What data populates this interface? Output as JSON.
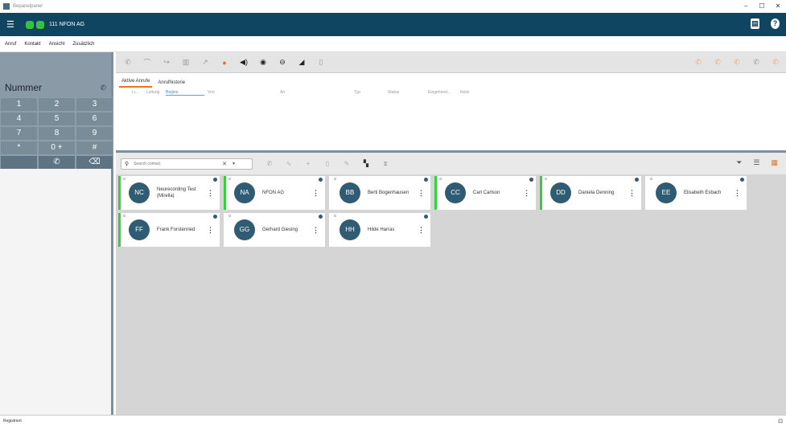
{
  "window": {
    "title": "Bepanelpanel"
  },
  "appbar": {
    "account": "111 NFON AG"
  },
  "menu": [
    "Anruf",
    "Kontakt",
    "Ansicht",
    "Zusätzlich"
  ],
  "dialpad": {
    "number_placeholder": "Nummer",
    "keys": [
      "1",
      "2",
      "3",
      "4",
      "5",
      "6",
      "7",
      "8",
      "9",
      "*",
      "0 +",
      "#"
    ]
  },
  "tabs": [
    "Aktive Anrufe",
    "Anrufhistorie"
  ],
  "columns": [
    "Li...",
    "Leitung",
    "Beginn",
    "Von",
    "An",
    "Typ",
    "Status",
    "Eingehend...",
    "Notiz"
  ],
  "search": {
    "placeholder": "Search contact"
  },
  "contacts": [
    {
      "initials": "NC",
      "name": "Neurecording Test (Mirella)",
      "presence": "green",
      "row": 0,
      "col": 0
    },
    {
      "initials": "NA",
      "name": "NFON AG",
      "presence": "green",
      "row": 0,
      "col": 1
    },
    {
      "initials": "BB",
      "name": "Berti Bogenhausen",
      "presence": "none",
      "row": 0,
      "col": 2
    },
    {
      "initials": "CC",
      "name": "Carl Carlson",
      "presence": "green",
      "row": 0,
      "col": 3
    },
    {
      "initials": "DD",
      "name": "Daniela Denning",
      "presence": "green",
      "row": 0,
      "col": 4
    },
    {
      "initials": "EE",
      "name": "Elisabeth Esbach",
      "presence": "none",
      "row": 0,
      "col": 5
    },
    {
      "initials": "FF",
      "name": "Frank Forstenried",
      "presence": "green",
      "row": 1,
      "col": 0
    },
    {
      "initials": "GG",
      "name": "Gerhard Giesing",
      "presence": "none",
      "row": 1,
      "col": 1
    },
    {
      "initials": "HH",
      "name": "Hilde Harras",
      "presence": "none",
      "row": 1,
      "col": 2
    }
  ],
  "statusbar": {
    "text": "Registriert"
  },
  "colors": {
    "brand": "#0f4560",
    "accent": "#e87521",
    "presence_green": "#34d13b"
  }
}
